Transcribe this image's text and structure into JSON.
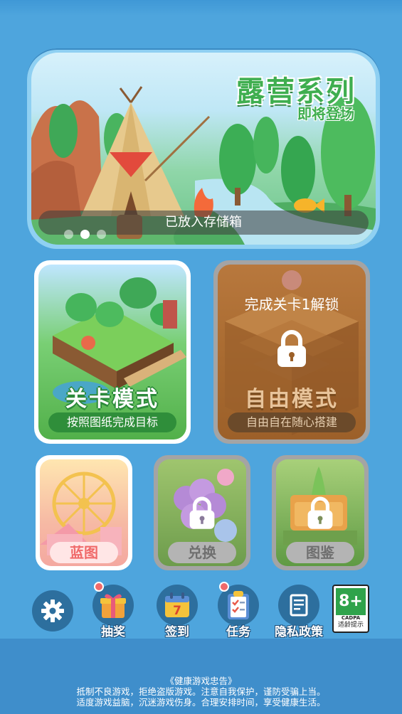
{
  "banner": {
    "title": "露营系列",
    "subtitle": "即将登场",
    "caption": "已放入存储箱",
    "page_count": 3,
    "active_page": 2
  },
  "modes": {
    "level": {
      "title": "关卡模式",
      "desc": "按照图纸完成目标"
    },
    "free": {
      "title": "自由模式",
      "desc": "自由自在随心搭建",
      "lock_text": "完成关卡1解锁"
    }
  },
  "small_cards": {
    "blueprint": "蓝图",
    "exchange": "兑换",
    "guide": "图鉴"
  },
  "bottom_bar": {
    "settings": {
      "icon": "gear-icon"
    },
    "lottery": {
      "label": "抽奖",
      "icon": "gift-icon"
    },
    "checkin": {
      "label": "签到",
      "icon": "calendar-icon",
      "day": "7"
    },
    "tasks": {
      "label": "任务",
      "icon": "clipboard-icon"
    },
    "privacy": {
      "label": "隐私政策",
      "icon": "document-icon"
    },
    "age_rating": {
      "rating": "8+",
      "org": "CADPA",
      "label": "适龄提示"
    }
  },
  "footer": {
    "title": "《健康游戏忠告》",
    "line1": "抵制不良游戏，拒绝盗版游戏。注意自我保护，谨防受骗上当。",
    "line2": "适度游戏益脑，沉迷游戏伤身。合理安排时间，享受健康生活。"
  },
  "colors": {
    "background": "#4ea5dd",
    "accent_green": "#3fae4f",
    "badge_red": "#f06a6a",
    "locked_gray": "#a4a4a4"
  }
}
